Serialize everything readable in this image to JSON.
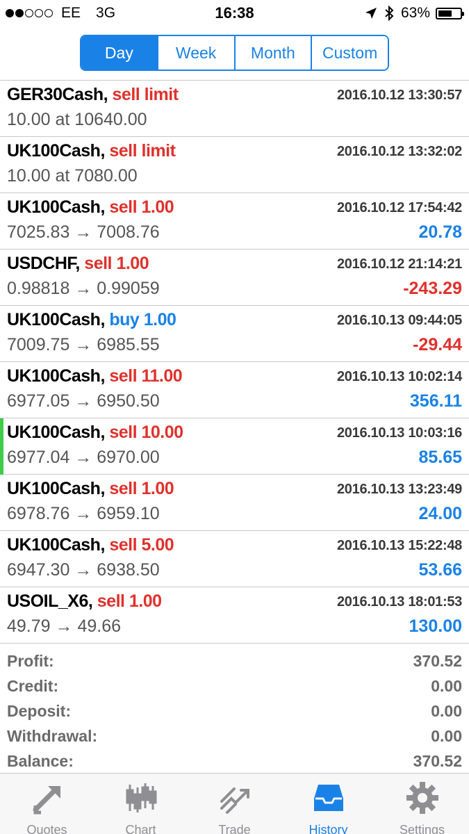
{
  "status_bar": {
    "carrier": "EE",
    "network": "3G",
    "time": "16:38",
    "battery": "63%",
    "battery_level": 0.63
  },
  "period_tabs": [
    {
      "label": "Day",
      "active": true
    },
    {
      "label": "Week",
      "active": false
    },
    {
      "label": "Month",
      "active": false
    },
    {
      "label": "Custom",
      "active": false
    }
  ],
  "orders": [
    {
      "symbol": "GER30Cash,",
      "action": "sell limit",
      "side": "sell",
      "time": "2016.10.12 13:30:57",
      "detail": "10.00 at 10640.00",
      "profit": "",
      "marked": false
    },
    {
      "symbol": "UK100Cash,",
      "action": "sell limit",
      "side": "sell",
      "time": "2016.10.12 13:32:02",
      "detail": "10.00 at 7080.00",
      "profit": "",
      "marked": false
    },
    {
      "symbol": "UK100Cash,",
      "action": "sell 1.00",
      "side": "sell",
      "time": "2016.10.12 17:54:42",
      "detail": "7025.83 → 7008.76",
      "profit": "20.78",
      "marked": false
    },
    {
      "symbol": "USDCHF,",
      "action": "sell 1.00",
      "side": "sell",
      "time": "2016.10.12 21:14:21",
      "detail": "0.98818 → 0.99059",
      "profit": "-243.29",
      "marked": false
    },
    {
      "symbol": "UK100Cash,",
      "action": "buy 1.00",
      "side": "buy",
      "time": "2016.10.13 09:44:05",
      "detail": "7009.75 → 6985.55",
      "profit": "-29.44",
      "marked": false
    },
    {
      "symbol": "UK100Cash,",
      "action": "sell 11.00",
      "side": "sell",
      "time": "2016.10.13 10:02:14",
      "detail": "6977.05 → 6950.50",
      "profit": "356.11",
      "marked": false
    },
    {
      "symbol": "UK100Cash,",
      "action": "sell 10.00",
      "side": "sell",
      "time": "2016.10.13 10:03:16",
      "detail": "6977.04 → 6970.00",
      "profit": "85.65",
      "marked": true
    },
    {
      "symbol": "UK100Cash,",
      "action": "sell 1.00",
      "side": "sell",
      "time": "2016.10.13 13:23:49",
      "detail": "6978.76 → 6959.10",
      "profit": "24.00",
      "marked": false
    },
    {
      "symbol": "UK100Cash,",
      "action": "sell 5.00",
      "side": "sell",
      "time": "2016.10.13 15:22:48",
      "detail": "6947.30 → 6938.50",
      "profit": "53.66",
      "marked": false
    },
    {
      "symbol": "USOIL_X6,",
      "action": "sell 1.00",
      "side": "sell",
      "time": "2016.10.13 18:01:53",
      "detail": "49.79 → 49.66",
      "profit": "130.00",
      "marked": false
    }
  ],
  "summary": [
    {
      "label": "Profit:",
      "value": "370.52"
    },
    {
      "label": "Credit:",
      "value": "0.00"
    },
    {
      "label": "Deposit:",
      "value": "0.00"
    },
    {
      "label": "Withdrawal:",
      "value": "0.00"
    },
    {
      "label": "Balance:",
      "value": "370.52"
    }
  ],
  "tab_bar": [
    {
      "label": "Quotes",
      "icon": "quotes-icon",
      "active": false
    },
    {
      "label": "Chart",
      "icon": "chart-icon",
      "active": false
    },
    {
      "label": "Trade",
      "icon": "trade-icon",
      "active": false
    },
    {
      "label": "History",
      "icon": "history-icon",
      "active": true
    },
    {
      "label": "Settings",
      "icon": "settings-icon",
      "active": false
    }
  ],
  "colors": {
    "accent": "#1a82e6",
    "sell": "#e0312c",
    "marker": "#3fcc4a"
  }
}
